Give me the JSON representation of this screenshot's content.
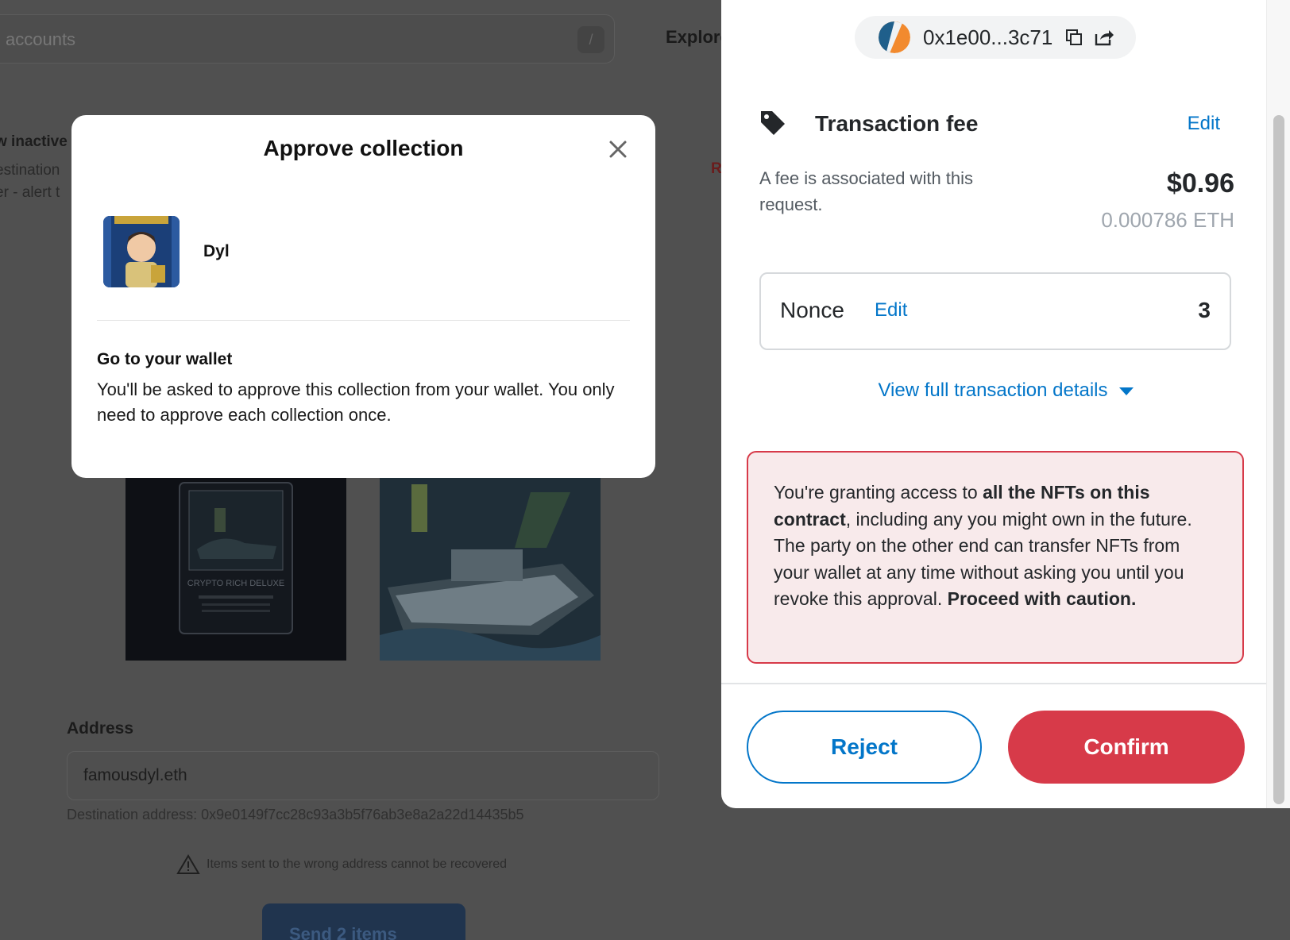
{
  "background_page": {
    "search_placeholder": "accounts",
    "search_shortcut": "/",
    "nav_explore": "Explore",
    "inactive_label": "w inactive",
    "destination_label": "estination",
    "alert_label": "er - alert t",
    "truncated_right_text": "R",
    "nft_1_title": "CRYPTO RICH DELUXE",
    "address_label": "Address",
    "address_value": "famousdyl.eth",
    "destination_address": "Destination address: 0x9e0149f7cc28c93a3b5f76ab3e8a2a22d14435b5",
    "warning_text": "Items sent to the wrong address cannot be recovered",
    "send_button": "Send 2 items"
  },
  "approve_modal": {
    "title": "Approve collection",
    "collection_name": "Dyl",
    "heading": "Go to your wallet",
    "body": "You'll be asked to approve this collection from your wallet. You only need to approve each collection once."
  },
  "wallet": {
    "account_address": "0x1e00...3c71",
    "fee_title": "Transaction fee",
    "fee_edit": "Edit",
    "fee_description": "A fee is associated with this request.",
    "fee_usd": "$0.96",
    "fee_eth": "0.000786 ETH",
    "nonce_label": "Nonce",
    "nonce_edit": "Edit",
    "nonce_value": "3",
    "view_details": "View full transaction details",
    "warning": {
      "part1": "You're granting access to ",
      "bold1": "all the NFTs on this contract",
      "part2": ", including any you might own in the future. The party on the other end can transfer NFTs from your wallet at any time without asking you until you revoke this approval. ",
      "bold2": "Proceed with caution."
    },
    "reject_button": "Reject",
    "confirm_button": "Confirm"
  },
  "colors": {
    "link_blue": "#0376c9",
    "danger_red": "#d73a49",
    "warning_bg": "#f8eaeb"
  }
}
